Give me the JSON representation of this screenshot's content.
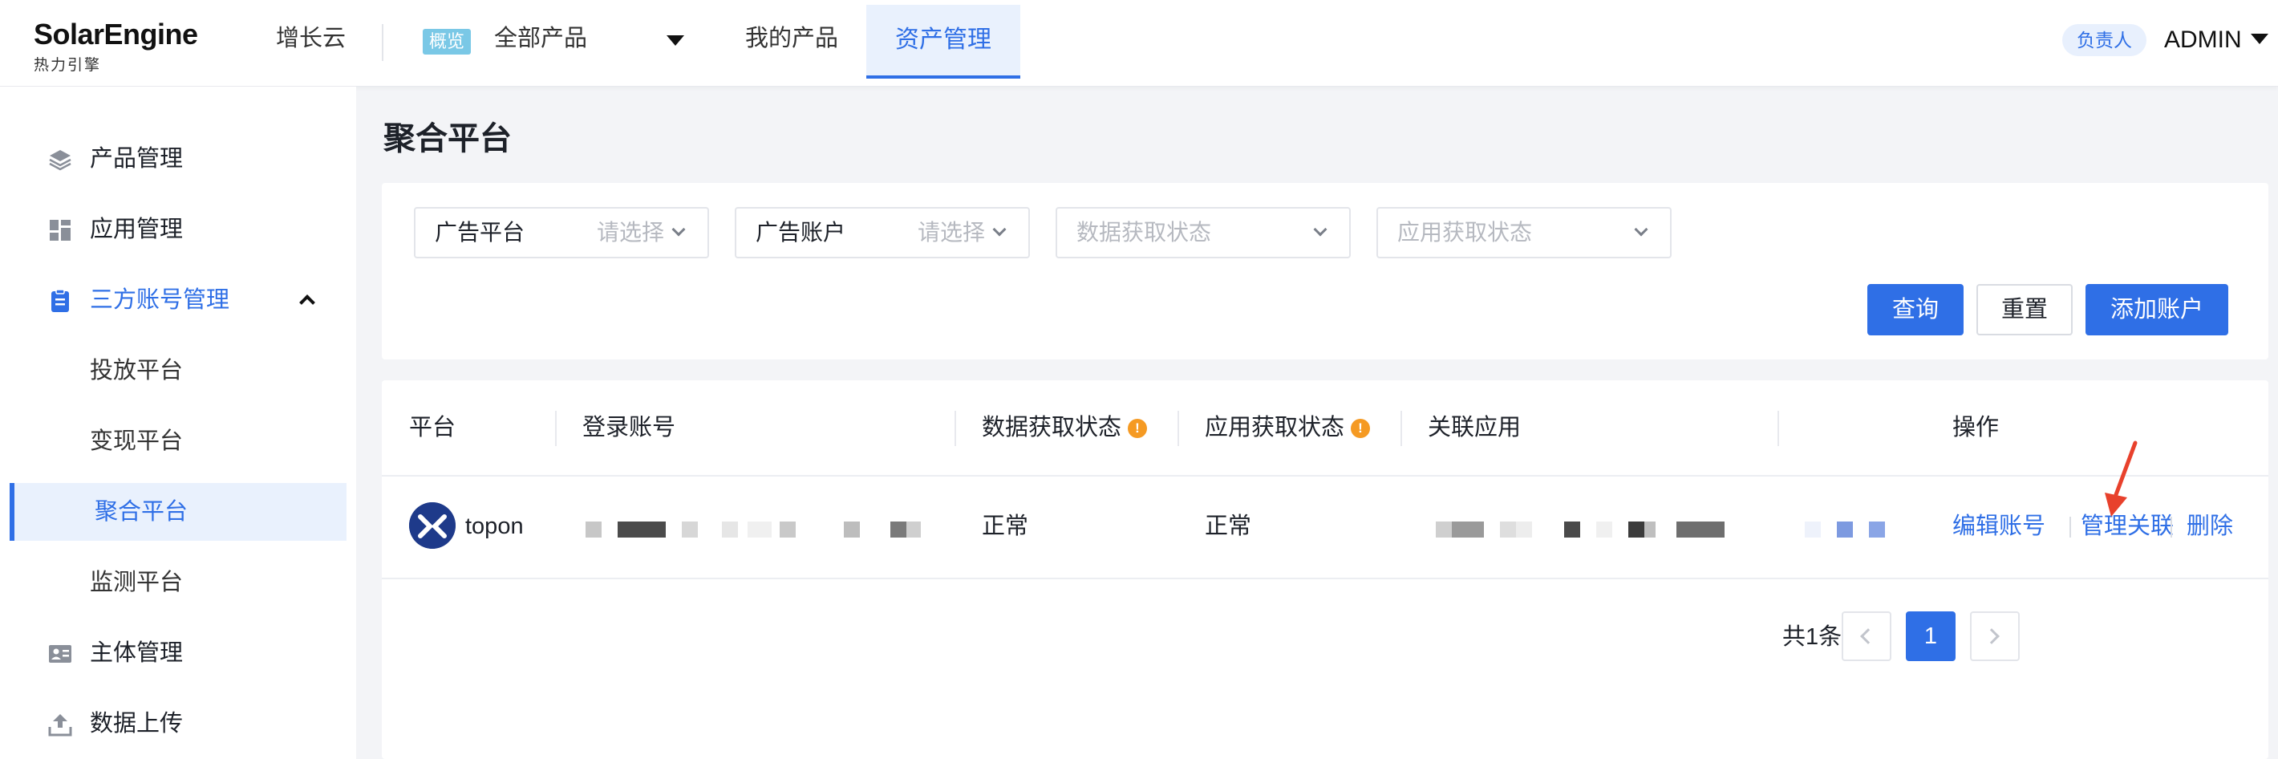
{
  "brand": {
    "name": "SolarEngine",
    "subtitle": "热力引擎"
  },
  "topnav": {
    "growth_cloud": "增长云",
    "overview_badge": "概览",
    "product_select": "全部产品",
    "my_products": "我的产品",
    "asset_management": "资产管理",
    "owner_badge": "负责人",
    "user": "ADMIN"
  },
  "sidebar": {
    "items": [
      {
        "label": "产品管理",
        "icon": "layers-icon"
      },
      {
        "label": "应用管理",
        "icon": "app-grid-icon"
      },
      {
        "label": "三方账号管理",
        "icon": "clipboard-icon",
        "expanded": true
      },
      {
        "label": "投放平台"
      },
      {
        "label": "变现平台"
      },
      {
        "label": "聚合平台",
        "active": true
      },
      {
        "label": "监测平台"
      },
      {
        "label": "主体管理",
        "icon": "id-card-icon"
      },
      {
        "label": "数据上传",
        "icon": "upload-icon"
      }
    ]
  },
  "page": {
    "title": "聚合平台"
  },
  "filters": {
    "ad_platform": {
      "label": "广告平台",
      "placeholder": "请选择"
    },
    "ad_account": {
      "label": "广告账户",
      "placeholder": "请选择"
    },
    "data_status": {
      "placeholder": "数据获取状态"
    },
    "app_status": {
      "placeholder": "应用获取状态"
    },
    "query_button": "查询",
    "reset_button": "重置",
    "add_button": "添加账户"
  },
  "table": {
    "columns": {
      "platform": "平台",
      "login_account": "登录账号",
      "data_status": "数据获取状态",
      "app_status": "应用获取状态",
      "linked_apps": "关联应用",
      "actions": "操作"
    },
    "rows": [
      {
        "platform": "topon",
        "data_status": "正常",
        "app_status": "正常",
        "actions": {
          "edit": "编辑账号",
          "manage": "管理关联",
          "delete": "删除"
        }
      }
    ]
  },
  "pagination": {
    "total": "共1条",
    "current": "1"
  },
  "colors": {
    "accent": "#2f6fe6",
    "warning": "#f59a23",
    "annotation_arrow": "#e8412c"
  }
}
